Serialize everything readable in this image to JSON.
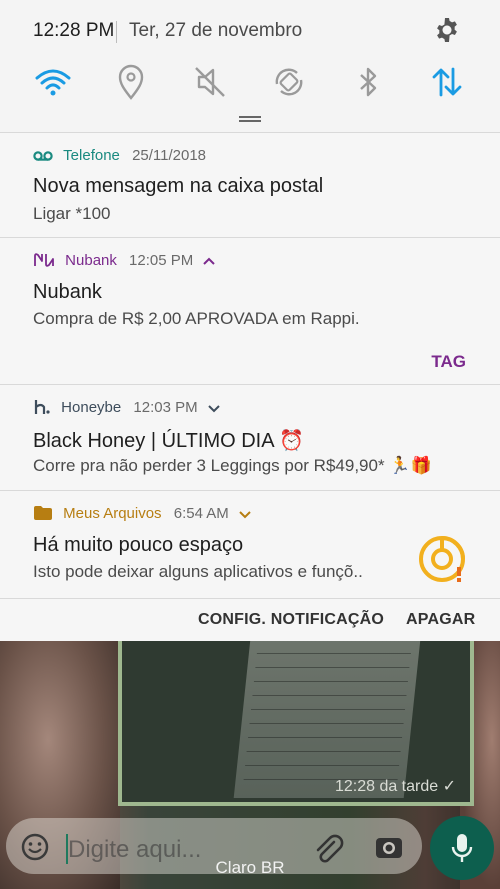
{
  "status_bar": {
    "time": "12:28 PM",
    "date": "Ter, 27 de novembro"
  },
  "quick_settings": [
    {
      "name": "wifi",
      "active": true
    },
    {
      "name": "location",
      "active": false
    },
    {
      "name": "mute",
      "active": false
    },
    {
      "name": "auto-rotate",
      "active": false
    },
    {
      "name": "bluetooth",
      "active": false
    },
    {
      "name": "mobile-data",
      "active": true
    }
  ],
  "colors": {
    "accent": "#1a9be3",
    "inactive": "#9a9a9a",
    "telefone": "#1a8a80",
    "nubank": "#7b2a8d",
    "honeybe": "#3e4d5c",
    "arquivos": "#b77e12"
  },
  "notifications": [
    {
      "app": "Telefone",
      "time": "25/11/2018",
      "title": "Nova mensagem na caixa postal",
      "body": "Ligar *100",
      "icon": "voicemail-icon"
    },
    {
      "app": "Nubank",
      "time": "12:05 PM",
      "title": "Nubank",
      "body": "Compra de R$ 2,00 APROVADA em Rappi.",
      "action": "TAG",
      "icon": "nubank-icon"
    },
    {
      "app": "Honeybe",
      "time": "12:03 PM",
      "title": "Black Honey | ÚLTIMO DIA ⏰",
      "body": "Corre pra não perder 3 Leggings por  R$49,90* 🏃🎁",
      "icon": "honeybe-icon"
    },
    {
      "app": "Meus Arquivos",
      "time": "6:54 AM",
      "title": "Há muito pouco espaço",
      "body": "Isto pode deixar alguns aplicativos e funçõ..",
      "icon": "folder-icon"
    }
  ],
  "actions": {
    "settings": "CONFIG. NOTIFICAÇÃO",
    "clear": "APAGAR"
  },
  "background": {
    "photo_time": "12:28 da tarde ✓",
    "input_placeholder": "Digite aqui...",
    "carrier": "Claro BR"
  }
}
